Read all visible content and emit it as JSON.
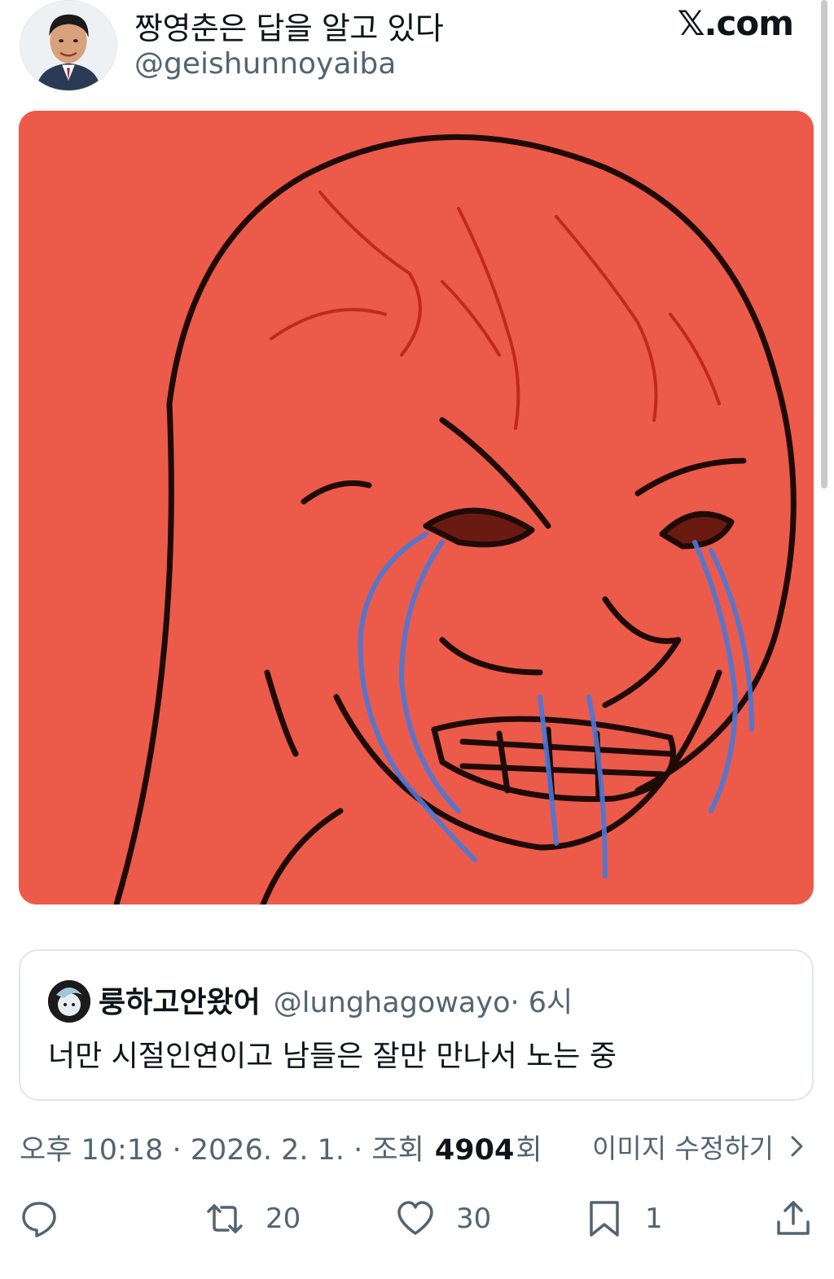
{
  "author": {
    "display_name": "짱영춘은 답을 알고 있다",
    "handle": "@geishunnoyaiba",
    "avatar_icon": "profile-photo-icon"
  },
  "brand": {
    "label": "𝕏.com"
  },
  "media": {
    "image_icon": "crying-wojak-meme-image"
  },
  "quoted_post": {
    "display_name": "룽하고안왔어",
    "handle": "@lunghagowayo",
    "time": " · 6시",
    "text": "너만 시절인연이고 남들은 잘만 만나서 노는 중"
  },
  "meta": {
    "time_prefix": "오후 10:18 · 2026. 2. 1. · 조회 ",
    "views": "4904",
    "views_suffix": "회",
    "edit_image_label": "이미지 수정하기"
  },
  "actions": {
    "reply_count": "",
    "repost_count": "20",
    "like_count": "30",
    "bookmark_count": "1"
  },
  "colors": {
    "primary_text": "#0f1419",
    "secondary_text": "#536471",
    "border": "#e1e6ea",
    "media_background": "#ec5a4a"
  }
}
